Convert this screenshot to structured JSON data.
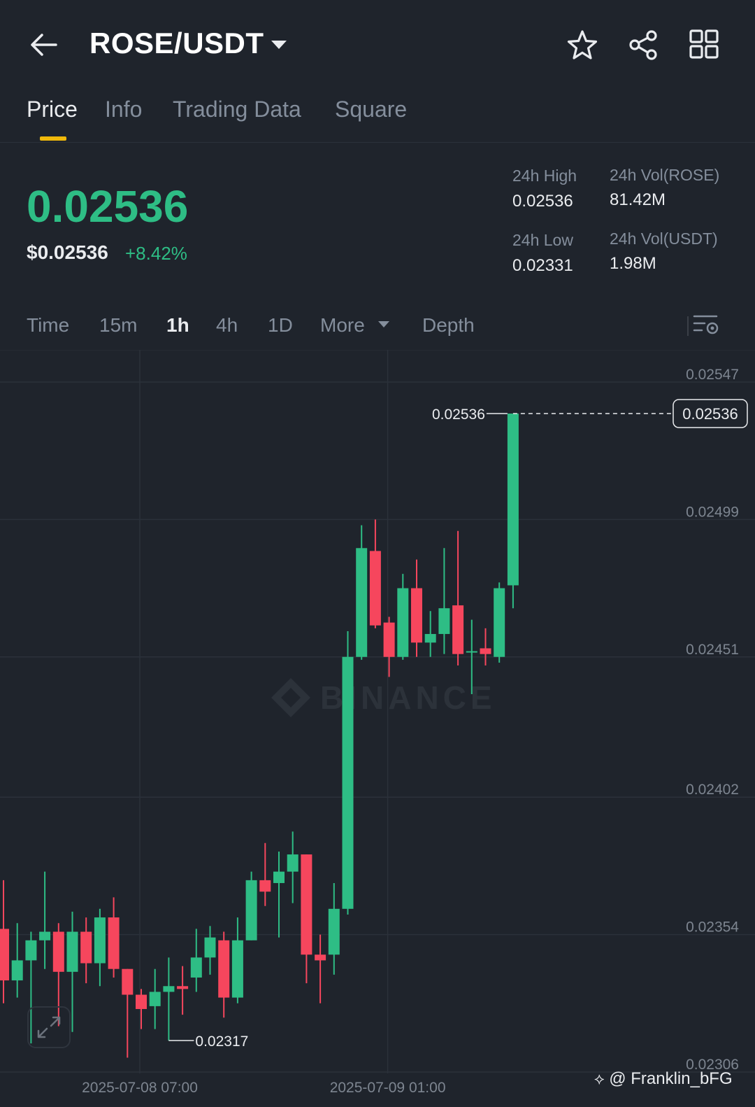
{
  "header": {
    "pair": "ROSE/USDT"
  },
  "tabs": [
    {
      "label": "Price",
      "active": true
    },
    {
      "label": "Info"
    },
    {
      "label": "Trading Data"
    },
    {
      "label": "Square"
    }
  ],
  "ticker": {
    "last_price": "0.02536",
    "usd_price": "$0.02536",
    "change_pct": "+8.42%",
    "high_label": "24h High",
    "high": "0.02536",
    "low_label": "24h Low",
    "low": "0.02331",
    "vol_base_label": "24h Vol(ROSE)",
    "vol_base": "81.42M",
    "vol_quote_label": "24h Vol(USDT)",
    "vol_quote": "1.98M"
  },
  "intervals": {
    "time": "Time",
    "m15": "15m",
    "h1": "1h",
    "h4": "4h",
    "d1": "1D",
    "more": "More",
    "depth": "Depth",
    "active": "1h"
  },
  "watermark": {
    "logo_text": "BINANCE"
  },
  "footer": {
    "credit": "@ Franklin_bFG"
  },
  "colors": {
    "up": "#2ebd85",
    "down": "#f6465d",
    "accent": "#f0b90b",
    "background": "#1f242c"
  },
  "chart_data": {
    "type": "candlestick",
    "interval": "1h",
    "y_ticks": [
      "0.02547",
      "0.02499",
      "0.02451",
      "0.02402",
      "0.02354",
      "0.02306"
    ],
    "x_ticks": [
      {
        "label": "2025-07-08 07:00",
        "index": 10
      },
      {
        "label": "2025-07-09 01:00",
        "index": 28
      }
    ],
    "last_price_label": "0.02536",
    "high_marker": {
      "label": "0.02536",
      "index": 37,
      "value": 0.02536
    },
    "low_marker": {
      "label": "0.02317",
      "index": 12,
      "value": 0.02317
    },
    "candles": [
      {
        "o": 0.02356,
        "h": 0.02373,
        "l": 0.0233,
        "c": 0.02338
      },
      {
        "o": 0.02338,
        "h": 0.02358,
        "l": 0.02332,
        "c": 0.02345
      },
      {
        "o": 0.02345,
        "h": 0.02355,
        "l": 0.02316,
        "c": 0.02352
      },
      {
        "o": 0.02352,
        "h": 0.02376,
        "l": 0.02342,
        "c": 0.02355
      },
      {
        "o": 0.02355,
        "h": 0.02358,
        "l": 0.02322,
        "c": 0.02341
      },
      {
        "o": 0.02341,
        "h": 0.02362,
        "l": 0.0232,
        "c": 0.02355
      },
      {
        "o": 0.02355,
        "h": 0.0236,
        "l": 0.02337,
        "c": 0.02344
      },
      {
        "o": 0.02344,
        "h": 0.02363,
        "l": 0.02336,
        "c": 0.0236
      },
      {
        "o": 0.0236,
        "h": 0.02367,
        "l": 0.02339,
        "c": 0.02342
      },
      {
        "o": 0.02342,
        "h": 0.02342,
        "l": 0.02311,
        "c": 0.02333
      },
      {
        "o": 0.02333,
        "h": 0.02335,
        "l": 0.02321,
        "c": 0.02328
      },
      {
        "o": 0.02329,
        "h": 0.02342,
        "l": 0.02321,
        "c": 0.02334
      },
      {
        "o": 0.02334,
        "h": 0.02346,
        "l": 0.02317,
        "c": 0.02336
      },
      {
        "o": 0.02336,
        "h": 0.02343,
        "l": 0.02326,
        "c": 0.02335
      },
      {
        "o": 0.02339,
        "h": 0.02356,
        "l": 0.02334,
        "c": 0.02346
      },
      {
        "o": 0.02346,
        "h": 0.02357,
        "l": 0.0234,
        "c": 0.02353
      },
      {
        "o": 0.02352,
        "h": 0.02355,
        "l": 0.02325,
        "c": 0.02332
      },
      {
        "o": 0.02332,
        "h": 0.0236,
        "l": 0.0233,
        "c": 0.02352
      },
      {
        "o": 0.02352,
        "h": 0.02376,
        "l": 0.02352,
        "c": 0.02373
      },
      {
        "o": 0.02373,
        "h": 0.02386,
        "l": 0.02364,
        "c": 0.02369
      },
      {
        "o": 0.02372,
        "h": 0.02383,
        "l": 0.02353,
        "c": 0.02376
      },
      {
        "o": 0.02376,
        "h": 0.0239,
        "l": 0.02365,
        "c": 0.02382
      },
      {
        "o": 0.02382,
        "h": 0.02382,
        "l": 0.02337,
        "c": 0.02347
      },
      {
        "o": 0.02347,
        "h": 0.02354,
        "l": 0.0233,
        "c": 0.02345
      },
      {
        "o": 0.02347,
        "h": 0.02372,
        "l": 0.0234,
        "c": 0.02363
      },
      {
        "o": 0.02363,
        "h": 0.0246,
        "l": 0.02361,
        "c": 0.02451
      },
      {
        "o": 0.02451,
        "h": 0.02497,
        "l": 0.0245,
        "c": 0.02489
      },
      {
        "o": 0.02488,
        "h": 0.02499,
        "l": 0.02461,
        "c": 0.02462
      },
      {
        "o": 0.02463,
        "h": 0.02465,
        "l": 0.02444,
        "c": 0.02451
      },
      {
        "o": 0.02451,
        "h": 0.0248,
        "l": 0.0245,
        "c": 0.02475
      },
      {
        "o": 0.02475,
        "h": 0.02485,
        "l": 0.02451,
        "c": 0.02456
      },
      {
        "o": 0.02456,
        "h": 0.02467,
        "l": 0.02451,
        "c": 0.02459
      },
      {
        "o": 0.02459,
        "h": 0.02489,
        "l": 0.02452,
        "c": 0.02468
      },
      {
        "o": 0.02469,
        "h": 0.02495,
        "l": 0.02448,
        "c": 0.02452
      },
      {
        "o": 0.02453,
        "h": 0.02464,
        "l": 0.02438,
        "c": 0.02453
      },
      {
        "o": 0.02454,
        "h": 0.02461,
        "l": 0.02448,
        "c": 0.02452
      },
      {
        "o": 0.02451,
        "h": 0.02477,
        "l": 0.02449,
        "c": 0.02475
      },
      {
        "o": 0.02476,
        "h": 0.02536,
        "l": 0.02468,
        "c": 0.02536
      }
    ],
    "ylim": [
      0.02302,
      0.02558
    ]
  }
}
